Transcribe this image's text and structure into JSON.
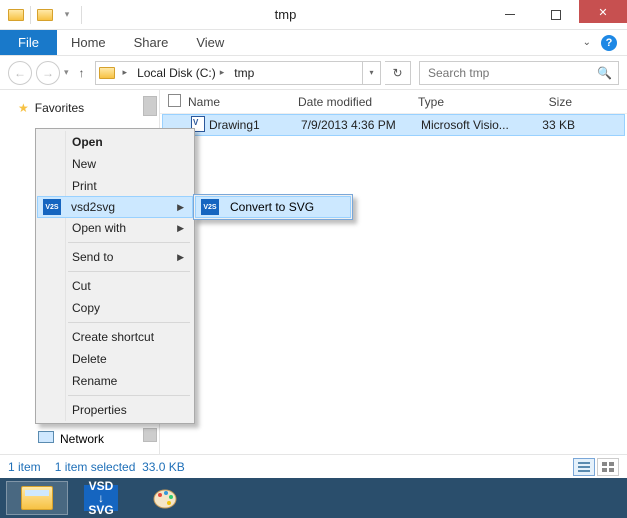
{
  "window": {
    "title": "tmp"
  },
  "ribbon": {
    "file": "File",
    "tabs": [
      "Home",
      "Share",
      "View"
    ]
  },
  "breadcrumb": {
    "parts": [
      "Local Disk (C:)",
      "tmp"
    ]
  },
  "search": {
    "placeholder": "Search tmp"
  },
  "tree": {
    "favorites": "Favorites",
    "network": "Network"
  },
  "columns": {
    "name": "Name",
    "date": "Date modified",
    "type": "Type",
    "size": "Size"
  },
  "files": [
    {
      "name": "Drawing1",
      "date": "7/9/2013 4:36 PM",
      "type": "Microsoft Visio...",
      "size": "33 KB"
    }
  ],
  "context_menu": {
    "open": "Open",
    "new": "New",
    "print": "Print",
    "vsd2svg": "vsd2svg",
    "openwith": "Open with",
    "sendto": "Send to",
    "cut": "Cut",
    "copy": "Copy",
    "shortcut": "Create shortcut",
    "delete": "Delete",
    "rename": "Rename",
    "properties": "Properties"
  },
  "submenu": {
    "convert": "Convert to SVG"
  },
  "status": {
    "count": "1 item",
    "selected": "1 item selected",
    "size": "33.0 KB"
  },
  "taskbar": {
    "vsd_line1": "VSD",
    "vsd_line2": "SVG"
  }
}
